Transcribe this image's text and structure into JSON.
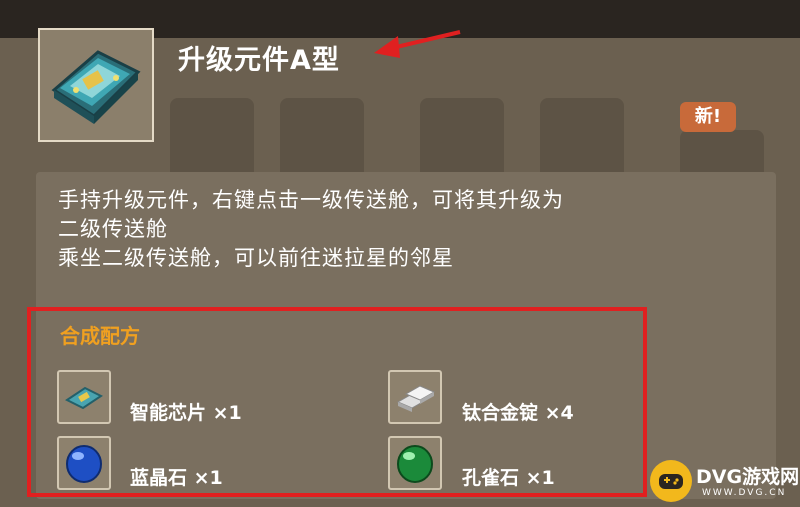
{
  "item": {
    "name": "升级元件A型",
    "icon": "upgrade-component-icon"
  },
  "background": {
    "new_badge": "新!"
  },
  "description": {
    "lines": [
      "手持升级元件，右键点击一级传送舱，可将其升级为",
      "二级传送舱",
      "乘坐二级传送舱，可以前往迷拉星的邻星"
    ]
  },
  "recipe": {
    "title": "合成配方",
    "ingredients": [
      {
        "name": "智能芯片",
        "qty": "×1",
        "icon": "chip-icon"
      },
      {
        "name": "钛合金锭",
        "qty": "×4",
        "icon": "titanium-ingot-icon"
      },
      {
        "name": "蓝晶石",
        "qty": "×1",
        "icon": "blue-crystal-icon"
      },
      {
        "name": "孔雀石",
        "qty": "×1",
        "icon": "malachite-icon"
      }
    ]
  },
  "watermark": {
    "main": "DVG游戏网",
    "sub": "WWW.DVG.CN"
  },
  "colors": {
    "recipe_title": "#f0a020",
    "highlight": "#e02020",
    "tooltip_bg": "#7a6f5f"
  }
}
